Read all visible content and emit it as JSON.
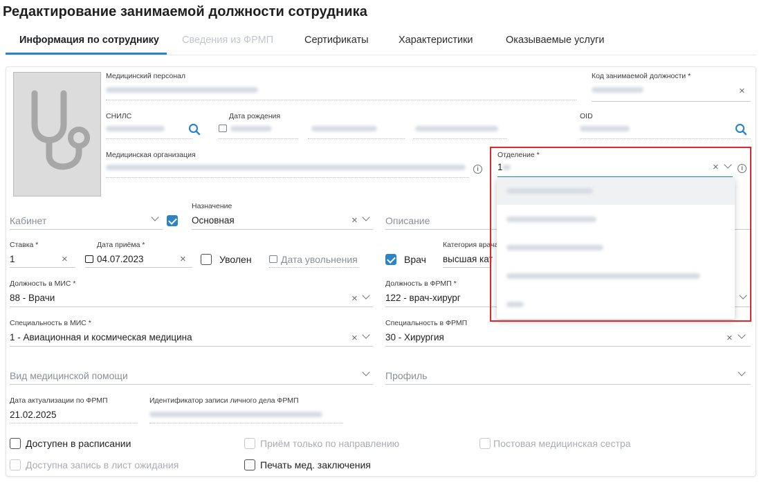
{
  "page_title": "Редактирование занимаемой должности сотрудника",
  "tabs": [
    {
      "label": "Информация по сотруднику",
      "state": "active"
    },
    {
      "label": "Сведения из ФРМП",
      "state": "disabled"
    },
    {
      "label": "Сертификаты",
      "state": "normal"
    },
    {
      "label": "Характеристики",
      "state": "normal"
    },
    {
      "label": "Оказываемые услуги",
      "state": "normal"
    }
  ],
  "accent_color": "#2a84c6",
  "highlight_color": "#e0262b",
  "photo_icon": "stethoscope-icon",
  "fields": {
    "med_staff": {
      "label": "Медицинский персонал"
    },
    "position_code": {
      "label": "Код занимаемой должности *"
    },
    "snils": {
      "label": "СНИЛС"
    },
    "birth_date": {
      "label": "Дата рождения"
    },
    "oid": {
      "label": "OID"
    },
    "med_org": {
      "label": "Медицинская организация"
    },
    "department": {
      "label": "Отделение *",
      "value": "1"
    },
    "cabinet": {
      "placeholder": "Кабинет"
    },
    "purpose": {
      "label": "Назначение",
      "value": "Основная"
    },
    "description": {
      "placeholder": "Описание"
    },
    "rate": {
      "label": "Ставка *",
      "value": "1"
    },
    "hire_date": {
      "label": "Дата приёма *",
      "value": "04.07.2023"
    },
    "dismissed": {
      "label": "Уволен"
    },
    "dismissal_date": {
      "placeholder": "Дата увольнения"
    },
    "doctor": {
      "label": "Врач"
    },
    "doctor_category": {
      "label": "Категория врача",
      "value": "высшая катег"
    },
    "mis_position": {
      "label": "Должность в МИС *",
      "value": "88 - Врачи"
    },
    "frmp_position": {
      "label": "Должность в ФРМП *",
      "value": "122 - врач-хирург"
    },
    "mis_specialty": {
      "label": "Специальность в МИС *",
      "value": "1 - Авиационная и космическая медицина"
    },
    "frmp_specialty": {
      "label": "Специальность в ФРМП",
      "value": "30 - Хирургия"
    },
    "care_type": {
      "placeholder": "Вид медицинской помощи"
    },
    "profile": {
      "placeholder": "Профиль"
    },
    "frmp_update_date": {
      "label": "Дата актуализации по ФРМП",
      "value": "21.02.2025"
    },
    "frmp_record_id": {
      "label": "Идентификатор записи личного дела ФРМП"
    }
  },
  "checkboxes": {
    "schedule_available": {
      "label": "Доступен в расписании",
      "checked": false,
      "disabled": false
    },
    "referral_only": {
      "label": "Приём только по направлению",
      "checked": false,
      "disabled": true
    },
    "ward_nurse": {
      "label": "Постовая медицинская сестра",
      "checked": false,
      "disabled": true
    },
    "waitlist_available": {
      "label": "Доступна запись в лист ожидания",
      "checked": false,
      "disabled": true
    },
    "print_conclusions": {
      "label": "Печать мед. заключения",
      "checked": false,
      "disabled": false
    }
  },
  "department_options_count_visible": 5
}
